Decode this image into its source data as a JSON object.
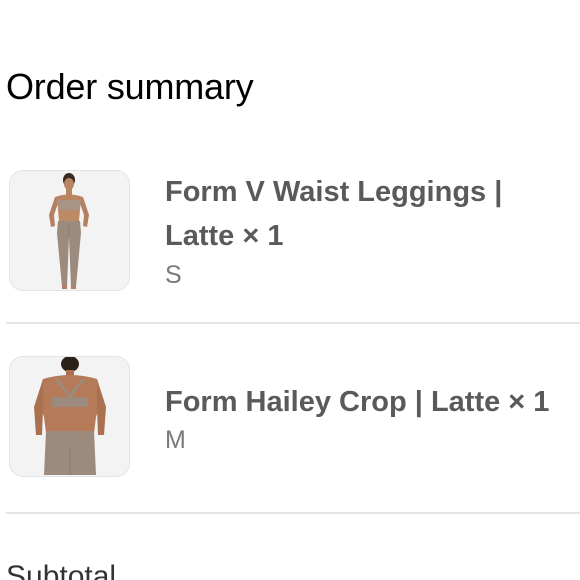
{
  "order_summary": {
    "title": "Order summary",
    "items": [
      {
        "name": "Form V Waist Leggings | Latte",
        "quantity": "× 1",
        "variant": "S"
      },
      {
        "name": "Form Hailey Crop | Latte",
        "quantity": "× 1",
        "variant": "M"
      }
    ],
    "subtotal_label": "Subtotal"
  },
  "colors": {
    "background": "#ffffff",
    "title_text": "#000000",
    "item_text": "#5a5a5a",
    "variant_text": "#7a7a7a",
    "divider": "#e4e4e4",
    "thumbnail_bg": "#f3f3f3",
    "product_latte": "#9c8b7c"
  }
}
